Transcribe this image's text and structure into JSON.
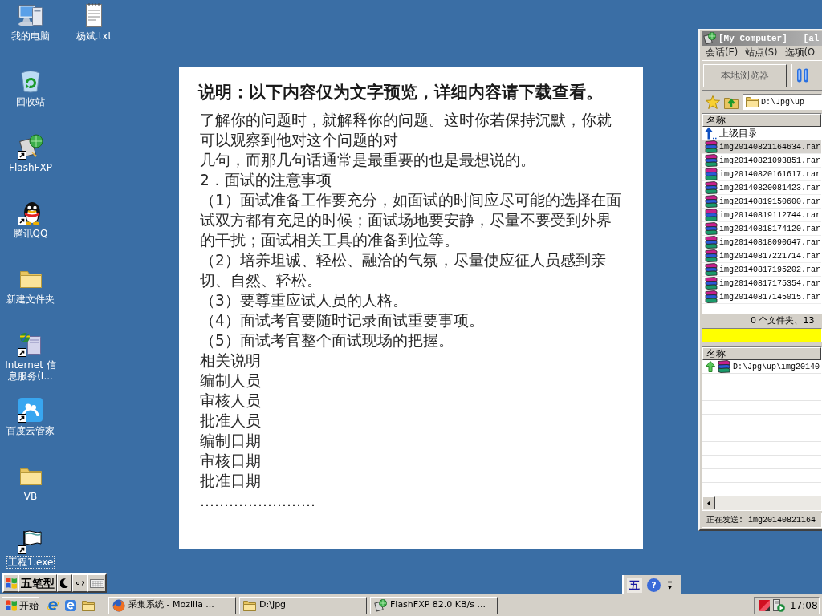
{
  "desktop_columns": [
    [
      {
        "label": "我的电脑",
        "kind": "computer",
        "shortcut": false,
        "selected": false
      },
      {
        "label": "回收站",
        "kind": "recyclebin",
        "shortcut": false,
        "selected": false
      },
      {
        "label": "FlashFXP",
        "kind": "ftpclient",
        "shortcut": true,
        "selected": false
      },
      {
        "label": "腾讯QQ",
        "kind": "penguin",
        "shortcut": true,
        "selected": false
      },
      {
        "label": "新建文件夹",
        "kind": "folder",
        "shortcut": false,
        "selected": false
      },
      {
        "label": "Internet 信息服务(I...",
        "kind": "server",
        "shortcut": true,
        "selected": false
      },
      {
        "label": "百度云管家",
        "kind": "cloud",
        "shortcut": true,
        "selected": false
      },
      {
        "label": "VB",
        "kind": "folder",
        "shortcut": false,
        "selected": false
      },
      {
        "label": "工程1.exe",
        "kind": "program",
        "shortcut": true,
        "selected": true
      }
    ],
    [
      {
        "label": "杨斌.txt",
        "kind": "textfile",
        "shortcut": false,
        "selected": false
      }
    ]
  ],
  "document": {
    "title": "说明：以下内容仅为文字预览，详细内容请下载查看。",
    "paragraphs": [
      [
        "了解你的问题时，就解释你的问题。这时你若保持沉默，你就",
        "可以观察到他对这个问题的对",
        "几句，而那几句话通常是最重要的也是最想说的。"
      ],
      [
        "2．面试的注意事项"
      ],
      [
        "（1）面试准备工作要充分，如面试的时间应尽可能的选择在面",
        "试双方都有充足的时候；面试场地要安静，尽量不要受到外界",
        "的干扰；面试相关工具的准备到位等。"
      ],
      [
        "（2）培养坦诚、轻松、融洽的气氛，尽量使应征人员感到亲",
        "切、自然、轻松。"
      ],
      [
        "（3）要尊重应试人员的人格。"
      ],
      [
        "（4）面试考官要随时记录面试重要事项。"
      ],
      [
        "（5）面试考官整个面试现场的把握。"
      ],
      [
        "相关说明"
      ],
      [
        "编制人员"
      ],
      [
        "审核人员"
      ],
      [
        "批准人员"
      ],
      [
        "编制日期"
      ],
      [
        "审核日期"
      ],
      [
        "批准日期"
      ]
    ],
    "ellipsis": "……………………"
  },
  "ftp_window": {
    "title": "[My Computer]   [al",
    "menu": [
      "会话(E)",
      "站点(S)",
      "选项(O"
    ],
    "toolbar_button": "本地浏览器",
    "path": "D:\\Jpg\\up",
    "file_list": {
      "column": "名称",
      "parent": "上级目录",
      "files": [
        {
          "name": "img20140821164634.rar",
          "selected": true
        },
        {
          "name": "img20140821093851.rar",
          "selected": false
        },
        {
          "name": "img20140820161617.rar",
          "selected": false
        },
        {
          "name": "img20140820081423.rar",
          "selected": false
        },
        {
          "name": "img20140819150600.rar",
          "selected": false
        },
        {
          "name": "img20140819112744.rar",
          "selected": false
        },
        {
          "name": "img20140818174120.rar",
          "selected": false
        },
        {
          "name": "img20140818090647.rar",
          "selected": false
        },
        {
          "name": "img20140817221714.rar",
          "selected": false
        },
        {
          "name": "img20140817195202.rar",
          "selected": false
        },
        {
          "name": "img20140817175354.rar",
          "selected": false
        },
        {
          "name": "img20140817145015.rar",
          "selected": false
        }
      ]
    },
    "summary": "0 个文件夹、13",
    "queue": {
      "column": "名称",
      "items": [
        {
          "path": "D:\\Jpg\\up\\img20140"
        }
      ]
    },
    "status": "正在发送: img20140821164"
  },
  "ime_bar": {
    "mode": "五笔型"
  },
  "language_bar": {
    "ime": "五",
    "help": "?"
  },
  "taskbar": {
    "start": "开始",
    "tasks": [
      {
        "label": "采集系统 - Mozilla ...",
        "kind": "browser",
        "selected": false
      },
      {
        "label": "D:\\Jpg",
        "kind": "folder",
        "selected": false
      },
      {
        "label": "FlashFXP 82.0 KB/s ...",
        "kind": "ftp",
        "selected": false
      }
    ],
    "clock": "17:08"
  }
}
